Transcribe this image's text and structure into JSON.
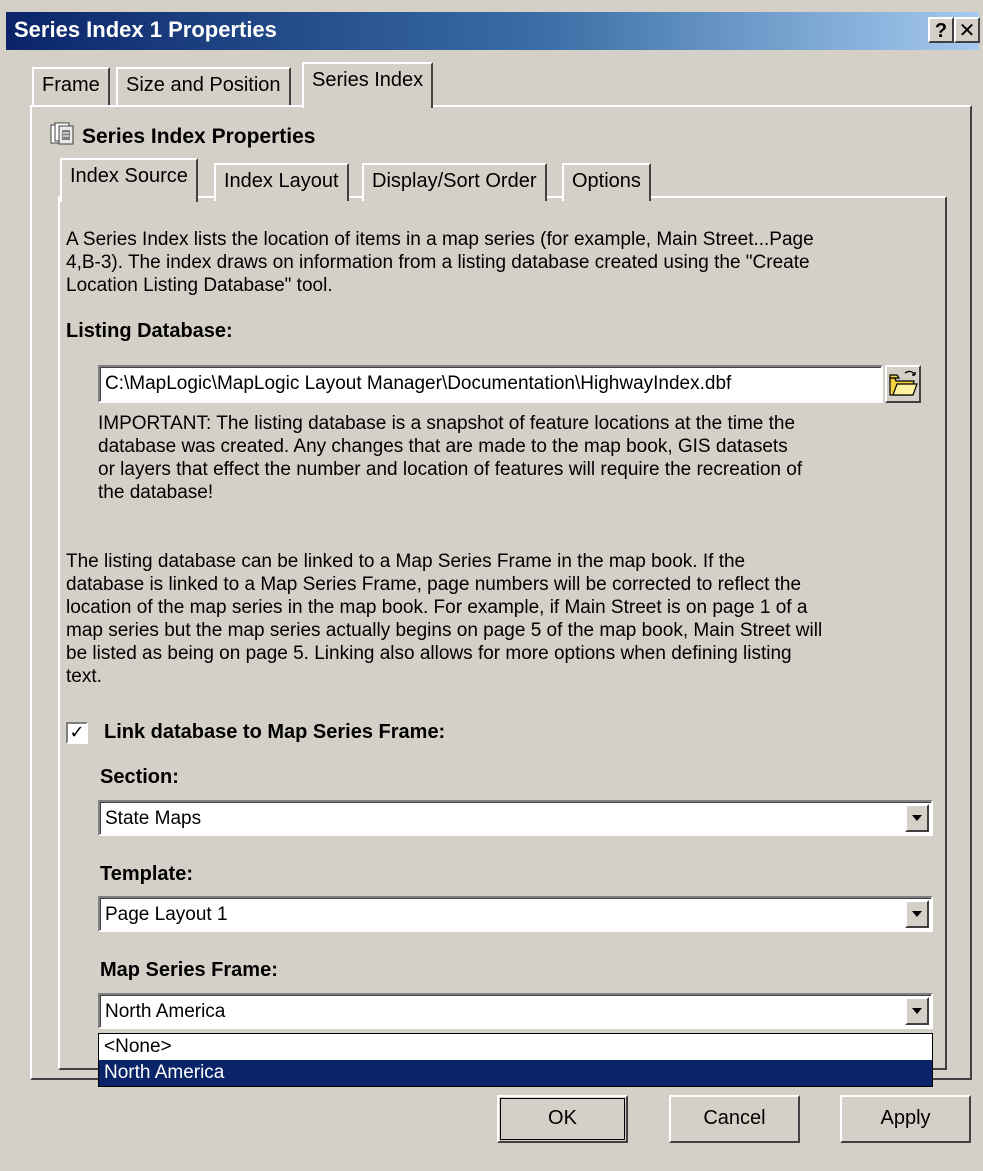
{
  "window": {
    "title": "Series Index 1 Properties",
    "help_label": "?",
    "close_label": "✕"
  },
  "outer_tabs": [
    "Frame",
    "Size and Position",
    "Series Index"
  ],
  "active_outer_tab": "Series Index",
  "section_title": "Series Index Properties",
  "inner_tabs": [
    "Index Source",
    "Index Layout",
    "Display/Sort Order",
    "Options"
  ],
  "active_inner_tab": "Index Source",
  "index_source": {
    "intro_lines": [
      "A Series Index lists the location of items in a map series (for example, Main Street...Page",
      "4,B-3).  The index draws on information from a listing database created using the \"Create",
      "Location Listing Database\" tool."
    ],
    "listing_db_label": "Listing Database:",
    "listing_db_path": "C:\\MapLogic\\MapLogic Layout Manager\\Documentation\\HighwayIndex.dbf",
    "important_lines": [
      "IMPORTANT:  The listing database is a snapshot of feature locations at the time the",
      "database was created.  Any changes that are made to the map book, GIS datasets",
      "or layers that effect the number and location of features will require the recreation of",
      "the database!"
    ],
    "link_lines": [
      "The listing database can be linked to a Map Series Frame in the map book.  If the",
      "database is linked to a Map Series Frame, page numbers will be corrected to reflect the",
      "location of the map series in the map book.  For example, if Main Street is on page 1 of a",
      "map series but the map series actually begins on page 5 of the map book, Main Street will",
      "be listed as being on page 5.  Linking also allows for more options when defining listing",
      "text."
    ],
    "link_checkbox_label": "Link database to Map Series Frame:",
    "link_checked": true,
    "section_label": "Section:",
    "section_value": "State Maps",
    "template_label": "Template:",
    "template_value": "Page Layout 1",
    "map_series_frame_label": "Map Series Frame:",
    "map_series_frame_value": "North America",
    "map_series_frame_options": [
      "<None>",
      "North America"
    ],
    "map_series_frame_selected": "North America"
  },
  "buttons": {
    "ok": "OK",
    "cancel": "Cancel",
    "apply": "Apply"
  },
  "colors": {
    "dialog_face": "#d4d0c8",
    "title_bar_start": "#0a246a",
    "title_bar_end": "#a6caf0",
    "selection": "#0a246a"
  },
  "icons": {
    "header": "series-index-icon",
    "browse": "open-folder-icon",
    "combo": "chevron-down-icon"
  }
}
